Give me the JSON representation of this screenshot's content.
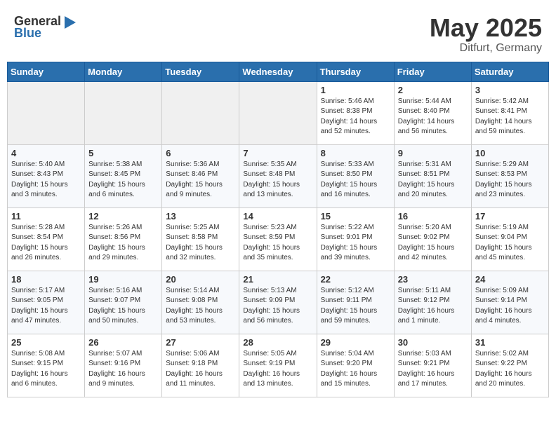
{
  "header": {
    "logo_general": "General",
    "logo_blue": "Blue",
    "title": "May 2025",
    "subtitle": "Ditfurt, Germany"
  },
  "days_of_week": [
    "Sunday",
    "Monday",
    "Tuesday",
    "Wednesday",
    "Thursday",
    "Friday",
    "Saturday"
  ],
  "weeks": [
    [
      {
        "day": "",
        "info": ""
      },
      {
        "day": "",
        "info": ""
      },
      {
        "day": "",
        "info": ""
      },
      {
        "day": "",
        "info": ""
      },
      {
        "day": "1",
        "info": "Sunrise: 5:46 AM\nSunset: 8:38 PM\nDaylight: 14 hours\nand 52 minutes."
      },
      {
        "day": "2",
        "info": "Sunrise: 5:44 AM\nSunset: 8:40 PM\nDaylight: 14 hours\nand 56 minutes."
      },
      {
        "day": "3",
        "info": "Sunrise: 5:42 AM\nSunset: 8:41 PM\nDaylight: 14 hours\nand 59 minutes."
      }
    ],
    [
      {
        "day": "4",
        "info": "Sunrise: 5:40 AM\nSunset: 8:43 PM\nDaylight: 15 hours\nand 3 minutes."
      },
      {
        "day": "5",
        "info": "Sunrise: 5:38 AM\nSunset: 8:45 PM\nDaylight: 15 hours\nand 6 minutes."
      },
      {
        "day": "6",
        "info": "Sunrise: 5:36 AM\nSunset: 8:46 PM\nDaylight: 15 hours\nand 9 minutes."
      },
      {
        "day": "7",
        "info": "Sunrise: 5:35 AM\nSunset: 8:48 PM\nDaylight: 15 hours\nand 13 minutes."
      },
      {
        "day": "8",
        "info": "Sunrise: 5:33 AM\nSunset: 8:50 PM\nDaylight: 15 hours\nand 16 minutes."
      },
      {
        "day": "9",
        "info": "Sunrise: 5:31 AM\nSunset: 8:51 PM\nDaylight: 15 hours\nand 20 minutes."
      },
      {
        "day": "10",
        "info": "Sunrise: 5:29 AM\nSunset: 8:53 PM\nDaylight: 15 hours\nand 23 minutes."
      }
    ],
    [
      {
        "day": "11",
        "info": "Sunrise: 5:28 AM\nSunset: 8:54 PM\nDaylight: 15 hours\nand 26 minutes."
      },
      {
        "day": "12",
        "info": "Sunrise: 5:26 AM\nSunset: 8:56 PM\nDaylight: 15 hours\nand 29 minutes."
      },
      {
        "day": "13",
        "info": "Sunrise: 5:25 AM\nSunset: 8:58 PM\nDaylight: 15 hours\nand 32 minutes."
      },
      {
        "day": "14",
        "info": "Sunrise: 5:23 AM\nSunset: 8:59 PM\nDaylight: 15 hours\nand 35 minutes."
      },
      {
        "day": "15",
        "info": "Sunrise: 5:22 AM\nSunset: 9:01 PM\nDaylight: 15 hours\nand 39 minutes."
      },
      {
        "day": "16",
        "info": "Sunrise: 5:20 AM\nSunset: 9:02 PM\nDaylight: 15 hours\nand 42 minutes."
      },
      {
        "day": "17",
        "info": "Sunrise: 5:19 AM\nSunset: 9:04 PM\nDaylight: 15 hours\nand 45 minutes."
      }
    ],
    [
      {
        "day": "18",
        "info": "Sunrise: 5:17 AM\nSunset: 9:05 PM\nDaylight: 15 hours\nand 47 minutes."
      },
      {
        "day": "19",
        "info": "Sunrise: 5:16 AM\nSunset: 9:07 PM\nDaylight: 15 hours\nand 50 minutes."
      },
      {
        "day": "20",
        "info": "Sunrise: 5:14 AM\nSunset: 9:08 PM\nDaylight: 15 hours\nand 53 minutes."
      },
      {
        "day": "21",
        "info": "Sunrise: 5:13 AM\nSunset: 9:09 PM\nDaylight: 15 hours\nand 56 minutes."
      },
      {
        "day": "22",
        "info": "Sunrise: 5:12 AM\nSunset: 9:11 PM\nDaylight: 15 hours\nand 59 minutes."
      },
      {
        "day": "23",
        "info": "Sunrise: 5:11 AM\nSunset: 9:12 PM\nDaylight: 16 hours\nand 1 minute."
      },
      {
        "day": "24",
        "info": "Sunrise: 5:09 AM\nSunset: 9:14 PM\nDaylight: 16 hours\nand 4 minutes."
      }
    ],
    [
      {
        "day": "25",
        "info": "Sunrise: 5:08 AM\nSunset: 9:15 PM\nDaylight: 16 hours\nand 6 minutes."
      },
      {
        "day": "26",
        "info": "Sunrise: 5:07 AM\nSunset: 9:16 PM\nDaylight: 16 hours\nand 9 minutes."
      },
      {
        "day": "27",
        "info": "Sunrise: 5:06 AM\nSunset: 9:18 PM\nDaylight: 16 hours\nand 11 minutes."
      },
      {
        "day": "28",
        "info": "Sunrise: 5:05 AM\nSunset: 9:19 PM\nDaylight: 16 hours\nand 13 minutes."
      },
      {
        "day": "29",
        "info": "Sunrise: 5:04 AM\nSunset: 9:20 PM\nDaylight: 16 hours\nand 15 minutes."
      },
      {
        "day": "30",
        "info": "Sunrise: 5:03 AM\nSunset: 9:21 PM\nDaylight: 16 hours\nand 17 minutes."
      },
      {
        "day": "31",
        "info": "Sunrise: 5:02 AM\nSunset: 9:22 PM\nDaylight: 16 hours\nand 20 minutes."
      }
    ]
  ]
}
